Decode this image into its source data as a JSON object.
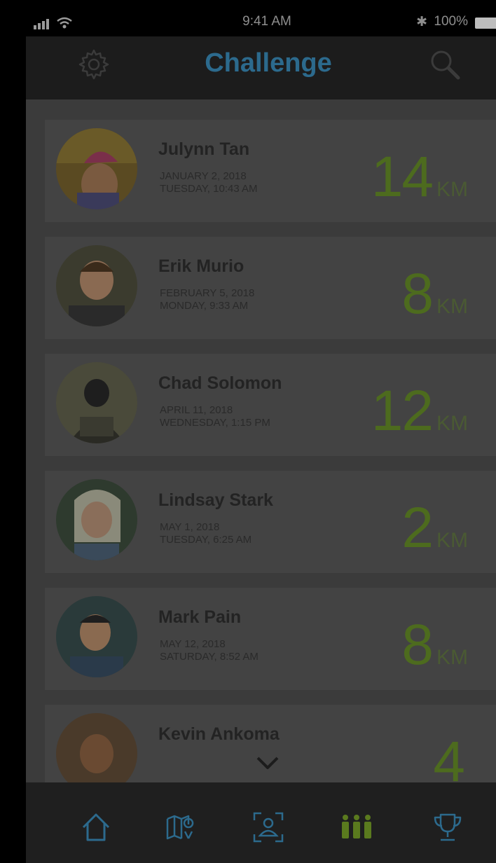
{
  "status_bar": {
    "time": "9:41 AM",
    "battery_percent": "100%",
    "bluetooth": "✱"
  },
  "nav": {
    "title": "Challenge",
    "left_icon": "gear-icon",
    "right_icon": "search-icon"
  },
  "entries": [
    {
      "name": "Julynn Tan",
      "date": "JANUARY 2, 2018",
      "day_time": "TUESDAY, 10:43 AM",
      "distance": "14",
      "unit": "KM"
    },
    {
      "name": "Erik Murio",
      "date": "FEBRUARY 5, 2018",
      "day_time": "MONDAY, 9:33 AM",
      "distance": "8",
      "unit": "KM"
    },
    {
      "name": "Chad Solomon",
      "date": "APRIL 11, 2018",
      "day_time": "WEDNESDAY, 1:15 PM",
      "distance": "12",
      "unit": "KM"
    },
    {
      "name": "Lindsay Stark",
      "date": "MAY 1, 2018",
      "day_time": "TUESDAY, 6:25 AM",
      "distance": "2",
      "unit": "KM"
    },
    {
      "name": "Mark Pain",
      "date": "MAY 12, 2018",
      "day_time": "SATURDAY, 8:52 AM",
      "distance": "8",
      "unit": "KM"
    },
    {
      "name": "Kevin Ankoma",
      "date": "",
      "day_time": "",
      "distance": "4",
      "unit": ""
    }
  ],
  "tabbar": {
    "tabs": [
      {
        "icon": "home-icon",
        "active": false
      },
      {
        "icon": "map-icon",
        "active": false
      },
      {
        "icon": "profile-scan-icon",
        "active": false
      },
      {
        "icon": "group-icon",
        "active": true
      },
      {
        "icon": "trophy-icon",
        "active": false
      }
    ]
  },
  "colors": {
    "accent_blue": "#2c6a8d",
    "accent_green": "#4d6b1e",
    "active_tab": "#5a7a1e"
  }
}
